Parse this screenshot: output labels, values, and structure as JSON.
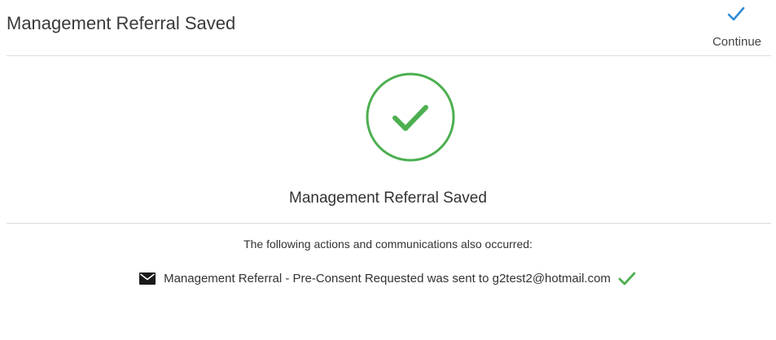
{
  "header": {
    "title": "Management Referral Saved"
  },
  "toolbar": {
    "continue_label": "Continue",
    "continue_icon": "checkmark-icon"
  },
  "main": {
    "status_icon": "success-circle-check-icon",
    "message": "Management Referral Saved",
    "actions_intro": "The following actions and communications also occurred:",
    "communications": [
      {
        "icon": "envelope-icon",
        "text": "Management Referral - Pre-Consent Requested was sent to g2test2@hotmail.com",
        "status_icon": "checkmark-icon"
      }
    ]
  },
  "colors": {
    "success_green": "#4caf50",
    "continue_blue": "#2e8bd6",
    "divider": "#dcdcdc",
    "text": "#333333"
  }
}
